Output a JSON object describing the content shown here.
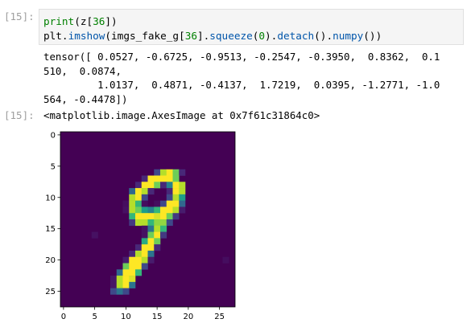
{
  "cells": [
    {
      "prompt": "[15]:"
    },
    {
      "prompt": "[15]:"
    }
  ],
  "code": {
    "line1": {
      "fn": "print",
      "a": "(z[",
      "num": "36",
      "b": "])"
    },
    "line2": {
      "a": "plt.",
      "imshow": "imshow",
      "b": "(imgs_fake_g[",
      "num1": "36",
      "c": "].",
      "squeeze": "squeeze",
      "d": "(",
      "num2": "0",
      "e": ").",
      "detach": "detach",
      "f": "().",
      "numpy": "numpy",
      "g": "())"
    }
  },
  "output": {
    "lines": [
      "tensor([ 0.0527, -0.6725, -0.9513, -0.2547, -0.3950,  0.8362,  0.1",
      "510,  0.0874,",
      "         1.0137,  0.4871, -0.4137,  1.7219,  0.0395, -1.2771, -1.0",
      "564, -0.4478])"
    ],
    "result": "<matplotlib.image.AxesImage at 0x7f61c31864c0>"
  },
  "chart_data": {
    "type": "heatmap",
    "colormap": "viridis",
    "size": [
      28,
      28
    ],
    "xticks": [
      "0",
      "5",
      "10",
      "15",
      "20",
      "25"
    ],
    "yticks": [
      "0",
      "5",
      "10",
      "15",
      "20",
      "25"
    ],
    "rows_sparse": {
      "6": {
        "15": 2,
        "16": 8,
        "17": 9,
        "18": 7,
        "19": 1
      },
      "7": {
        "13": 1,
        "14": 9,
        "15": 9,
        "16": 9,
        "17": 9,
        "18": 7
      },
      "8": {
        "12": 1,
        "13": 9,
        "14": 9,
        "15": 7,
        "16": 1,
        "17": 4,
        "18": 9,
        "19": 8
      },
      "9": {
        "11": 3,
        "12": 9,
        "13": 8,
        "14": 1,
        "17": 1,
        "18": 9,
        "19": 8
      },
      "10": {
        "11": 8,
        "12": 9,
        "13": 2,
        "17": 2,
        "18": 8,
        "19": 5
      },
      "11": {
        "10": 0.3,
        "11": 8,
        "12": 6,
        "13": 0.3,
        "15": 0.3,
        "16": 2,
        "17": 9,
        "18": 9,
        "19": 3
      },
      "12": {
        "10": 0.4,
        "11": 8,
        "12": 7,
        "13": 5,
        "14": 4,
        "15": 6,
        "16": 9,
        "17": 9,
        "18": 8,
        "19": 0.7
      },
      "13": {
        "11": 6,
        "12": 9,
        "13": 9,
        "14": 9,
        "15": 8.5,
        "16": 9,
        "17": 7,
        "18": 1.5
      },
      "14": {
        "11": 1.5,
        "12": 8,
        "13": 8,
        "14": 6,
        "15": 7.5,
        "16": 7.5,
        "17": 2
      },
      "15": {
        "13": 0.4,
        "14": 3.5,
        "15": 8,
        "16": 6
      },
      "16": {
        "5": 0.4,
        "13": 0.4,
        "14": 7,
        "15": 9,
        "16": 1.5
      },
      "17": {
        "13": 5.5,
        "14": 9,
        "15": 7
      },
      "18": {
        "12": 1,
        "13": 9,
        "14": 9,
        "15": 1
      },
      "19": {
        "11": 1,
        "12": 8,
        "13": 9,
        "14": 3.5
      },
      "20": {
        "10": 0.7,
        "11": 9,
        "12": 9,
        "13": 8,
        "14": 0.7,
        "26": 0.3
      },
      "21": {
        "10": 7,
        "11": 9,
        "12": 9,
        "13": 2
      },
      "22": {
        "9": 3,
        "10": 9,
        "11": 9,
        "12": 6
      },
      "23": {
        "8": 0.5,
        "9": 8,
        "10": 9,
        "11": 8.5
      },
      "24": {
        "8": 0.5,
        "9": 8,
        "10": 9,
        "11": 3.5
      },
      "25": {
        "8": 2,
        "9": 3.5,
        "10": 2
      }
    }
  }
}
